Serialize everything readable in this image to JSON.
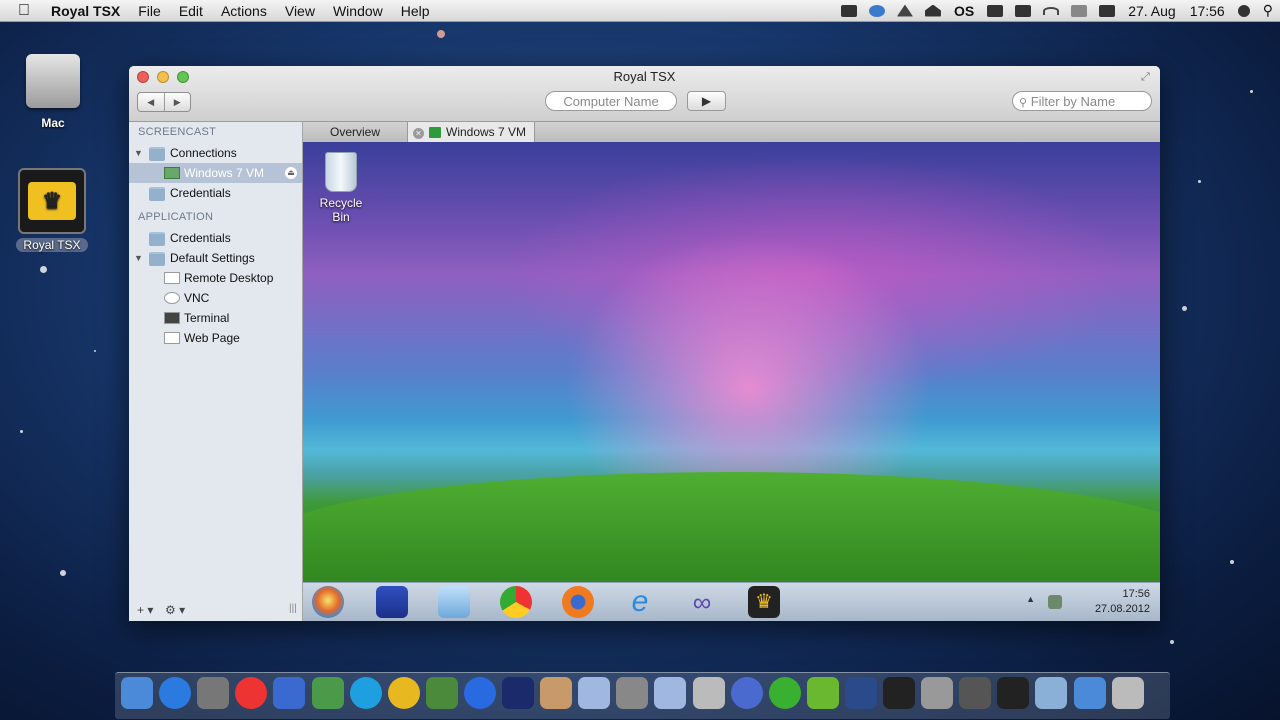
{
  "menubar": {
    "apple": "",
    "app": "Royal TSX",
    "menus": [
      "File",
      "Edit",
      "Actions",
      "View",
      "Window",
      "Help"
    ],
    "status_text": "OS",
    "date": "27. Aug",
    "time": "17:56"
  },
  "desktop": {
    "icons": [
      {
        "name": "Mac",
        "icon": "hard-drive-icon"
      },
      {
        "name": "Royal TSX",
        "icon": "crown-icon",
        "selected": true
      }
    ]
  },
  "window": {
    "title": "Royal TSX",
    "back": "◀",
    "forward": "▶",
    "computer_name_placeholder": "Computer Name",
    "connect": "▶",
    "filter_placeholder": "Filter by Name",
    "filter_icon": "🔍"
  },
  "sidebar": {
    "sections": [
      {
        "header": "SCREENCAST"
      },
      {
        "header": "APPLICATION"
      }
    ],
    "screencast_items": [
      {
        "label": "Connections",
        "icon": "folder-icon",
        "expanded": true
      },
      {
        "label": "Windows 7 VM",
        "icon": "remote-desktop-icon",
        "selected": true
      },
      {
        "label": "Credentials",
        "icon": "folder-icon"
      }
    ],
    "application_items": [
      {
        "label": "Credentials",
        "icon": "folder-icon"
      },
      {
        "label": "Default Settings",
        "icon": "folder-icon",
        "expanded": true
      },
      {
        "label": "Remote Desktop",
        "icon": "remote-desktop-icon"
      },
      {
        "label": "VNC",
        "icon": "vnc-icon"
      },
      {
        "label": "Terminal",
        "icon": "terminal-icon"
      },
      {
        "label": "Web Page",
        "icon": "web-page-icon"
      }
    ],
    "add": "+ ▾",
    "gear": "⚙ ▾",
    "resize": "|||"
  },
  "tabs": [
    {
      "label": "Overview"
    },
    {
      "label": "Windows 7 VM",
      "active": true
    }
  ],
  "remote": {
    "recycle_bin": "Recycle Bin",
    "taskbar_icons": [
      "start-orb-icon",
      "floppy-save-icon",
      "notepad-icon",
      "chrome-icon",
      "firefox-icon",
      "internet-explorer-icon",
      "infinity-icon",
      "royal-ts-icon"
    ],
    "tray_up": "▲",
    "clock_time": "17:56",
    "clock_date": "27.08.2012"
  },
  "dock": {
    "icons": [
      "finder-icon",
      "app-store-icon",
      "disk-utility-icon",
      "chrome-icon",
      "paper-plane-icon",
      "network-icon",
      "skype-icon",
      "world-icon",
      "evernote-icon",
      "itunes-icon",
      "photoshop-icon",
      "preview-icon",
      "tsx-icon",
      "xcode-icon",
      "tsx-icon-2",
      "script-icon",
      "globe-icon",
      "green-ball-icon",
      "leaf-icon",
      "remote-desktop-icon",
      "terminal-icon",
      "system-prefs-icon",
      "photo-icon",
      "royal-tsx-icon",
      "applications-folder-icon",
      "downloads-folder-icon",
      "trash-icon"
    ]
  },
  "colors": {
    "sidebar_bg": "#e3e8ee",
    "selection": "#b6c3d6",
    "close": "#ee5f5b",
    "minimize": "#f5c04a",
    "zoom": "#61c554"
  }
}
